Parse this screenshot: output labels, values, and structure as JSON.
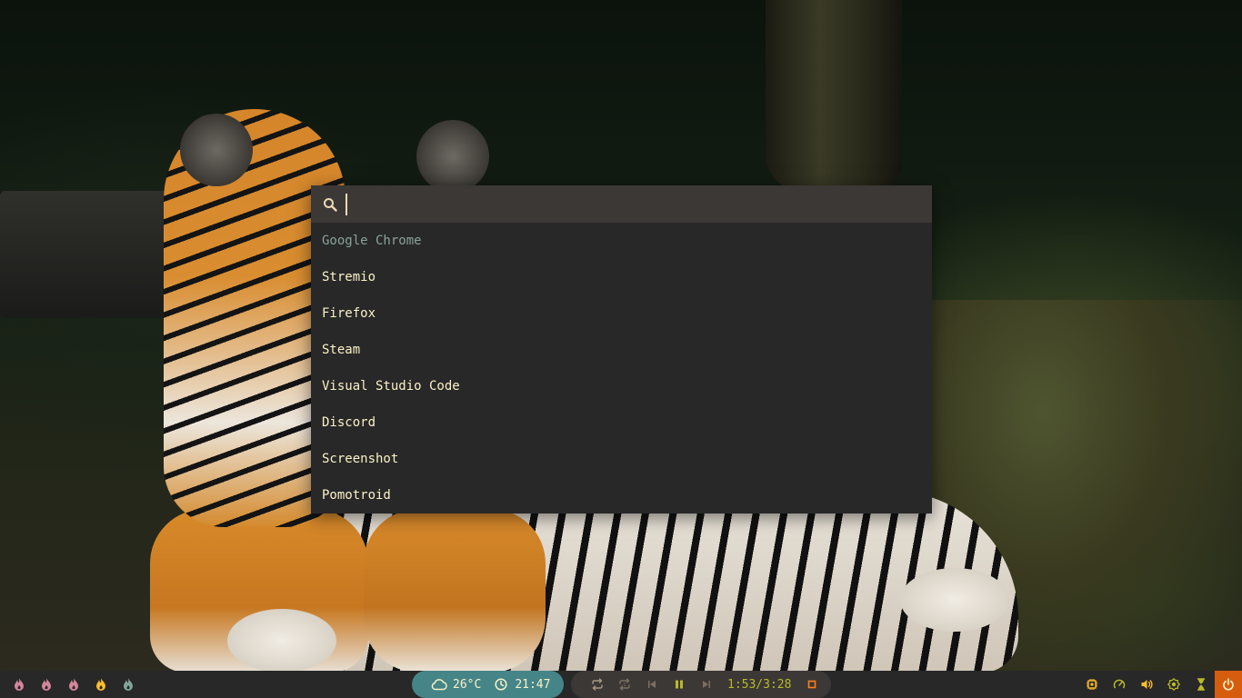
{
  "launcher": {
    "search": {
      "value": "",
      "placeholder": ""
    },
    "results": [
      {
        "label": "Google Chrome",
        "selected": true
      },
      {
        "label": "Stremio",
        "selected": false
      },
      {
        "label": "Firefox",
        "selected": false
      },
      {
        "label": "Steam",
        "selected": false
      },
      {
        "label": "Visual Studio Code",
        "selected": false
      },
      {
        "label": "Discord",
        "selected": false
      },
      {
        "label": "Screenshot",
        "selected": false
      },
      {
        "label": "Pomotroid",
        "selected": false
      }
    ]
  },
  "bar": {
    "workspaces": [
      {
        "icon": "flame-icon",
        "color": "#d3869b"
      },
      {
        "icon": "flame-icon",
        "color": "#d3869b"
      },
      {
        "icon": "flame-icon",
        "color": "#d3869b"
      },
      {
        "icon": "flame-icon",
        "color": "#fabd2f"
      },
      {
        "icon": "flame-icon",
        "color": "#83a598"
      }
    ],
    "weather": {
      "icon": "cloud-icon",
      "temperature": "26°C"
    },
    "clock": {
      "icon": "clock-icon",
      "time": "21:47"
    },
    "media": {
      "controls": [
        "repeat-icon",
        "shuffle-icon",
        "previous-icon",
        "pause-icon",
        "next-icon"
      ],
      "progress": "1:53/3:28",
      "stop_icon": "stop-icon"
    },
    "tray": [
      {
        "icon": "cpu-icon",
        "color": "#fabd2f"
      },
      {
        "icon": "speedometer-icon",
        "color": "#b8bb26"
      },
      {
        "icon": "volume-icon",
        "color": "#fabd2f"
      },
      {
        "icon": "brightness-icon",
        "color": "#b8bb26"
      },
      {
        "icon": "hourglass-icon",
        "color": "#b8bb26"
      }
    ],
    "power": {
      "icon": "power-icon",
      "color": "#d65d0e"
    }
  },
  "colors": {
    "launcher_bg": "#282828",
    "search_bg": "#3c3836",
    "text": "#fbf1c7",
    "selected_text": "#8aa39a",
    "accent_teal": "#458588",
    "accent_green": "#b8bb26",
    "accent_orange": "#d65d0e"
  }
}
